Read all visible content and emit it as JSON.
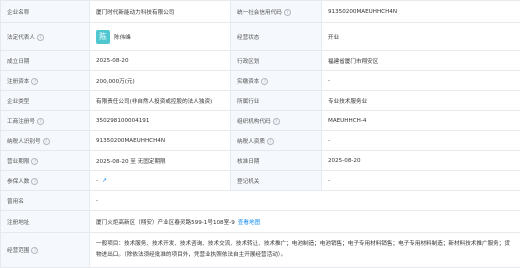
{
  "company": {
    "name_label": "企业名称",
    "name_value": "厦门时代新能动力科技有限公司",
    "credit_code_label": "统一社会信用代码",
    "credit_code_value": "91350200MAEUHHCH4N",
    "legal_rep_label": "法定代表人",
    "legal_rep_avatar": "陈",
    "legal_rep_name": "陈伟峰",
    "status_label": "经营状态",
    "status_value": "开业",
    "established_label": "成立日期",
    "established_value": "2025-08-20",
    "district_label": "行政区划",
    "district_value": "福建省厦门市翔安区",
    "reg_capital_label": "注册资本",
    "reg_capital_value": "200,000万(元)",
    "paid_capital_label": "实缴资本",
    "paid_capital_value": "-",
    "type_label": "企业类型",
    "type_value": "有限责任公司(非自然人投资或控股的法人独资)",
    "industry_label": "所属行业",
    "industry_value": "专业技术服务业",
    "reg_no_label": "工商注册号",
    "reg_no_value": "350298100004191",
    "org_code_label": "组织机构代码",
    "org_code_value": "MAEUHHCH-4",
    "taxpayer_label": "纳税人识别号",
    "taxpayer_value": "91350200MAEUHHCH4N",
    "taxpayer_qual_label": "纳税人资质",
    "taxpayer_qual_value": "-",
    "period_label": "营业期限",
    "period_value": "2025-08-20 至 无固定期限",
    "approved_label": "核准日期",
    "approved_value": "2025-08-20",
    "insured_label": "参保人数",
    "insured_value": "-",
    "reg_authority_label": "登记机关",
    "reg_authority_value": "-",
    "former_name_label": "曾用名",
    "former_name_value": "-",
    "address_label": "注册地址",
    "address_value": "厦门火炬高新区（翔安）产业区春灵路599-1号108室-9",
    "address_link": "查看地图",
    "scope_label": "经营范围",
    "scope_value": "一般项目：技术服务、技术开发、技术咨询、技术交流、技术转让、技术推广；电池制造；电池销售；电子专用材料销售；电子专用材料制造；新材料技术推广服务；货物进出口。（除依法须经批准的项目外，凭营业执照依法自主开展经营活动）。"
  },
  "colors": {
    "label_bg": "#f5f8fc",
    "border": "#e6e9ee",
    "link": "#128bed",
    "avatar_bg": "#4fc7d1"
  },
  "icons": {
    "help": "question-circle-icon",
    "trend": "trend-chart-icon"
  }
}
